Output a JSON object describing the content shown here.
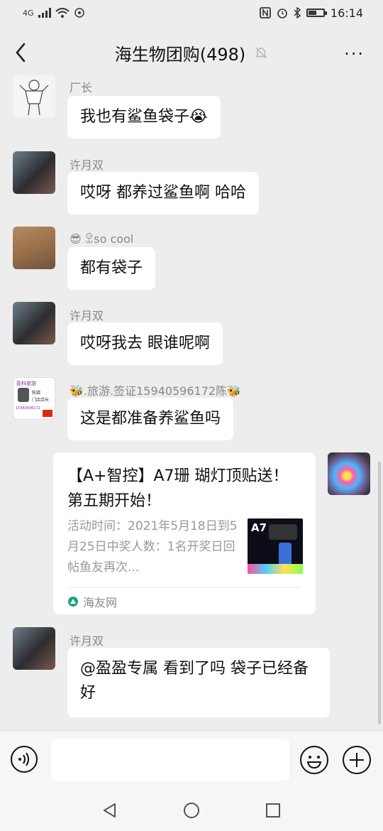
{
  "status_bar": {
    "network": "4G",
    "time": "16:14",
    "battery_level": 0.55
  },
  "header": {
    "title": "海生物团购(498)",
    "more": "···"
  },
  "messages": [
    {
      "sender": "厂长",
      "text": "我也有鲨鱼袋子😭"
    },
    {
      "sender": "许月双",
      "text": "哎呀 都养过鲨鱼啊  哈哈"
    },
    {
      "sender": "😎 ꀾso cool",
      "text": "都有袋子"
    },
    {
      "sender": "许月双",
      "text": "哎呀我去 眼谁呢啊"
    },
    {
      "sender": "🐝.旅游.签证15940596172陈🐝",
      "text": "这是都准备养鲨鱼吗"
    },
    {
      "sender": "许月双",
      "text": "@盈盈专属   看到了吗 袋子已经备好"
    }
  ],
  "link_card": {
    "title": "【A+智控】A7珊 瑚灯顶贴送！第五期开始！",
    "desc": "活动时间：2021年5月18日到5月25日中奖人数：1名开奖日回帖鱼友再次...",
    "thumb_label": "A7",
    "source": "海友网"
  },
  "avatar_text": {
    "brand": "盈科旅游",
    "name": "陈娣",
    "role": "门店店长",
    "phone": "15940596172"
  },
  "colors": {
    "background": "#ededed",
    "bubble": "#ffffff",
    "meta_text": "#888888",
    "source_icon": "#1aa37a"
  }
}
